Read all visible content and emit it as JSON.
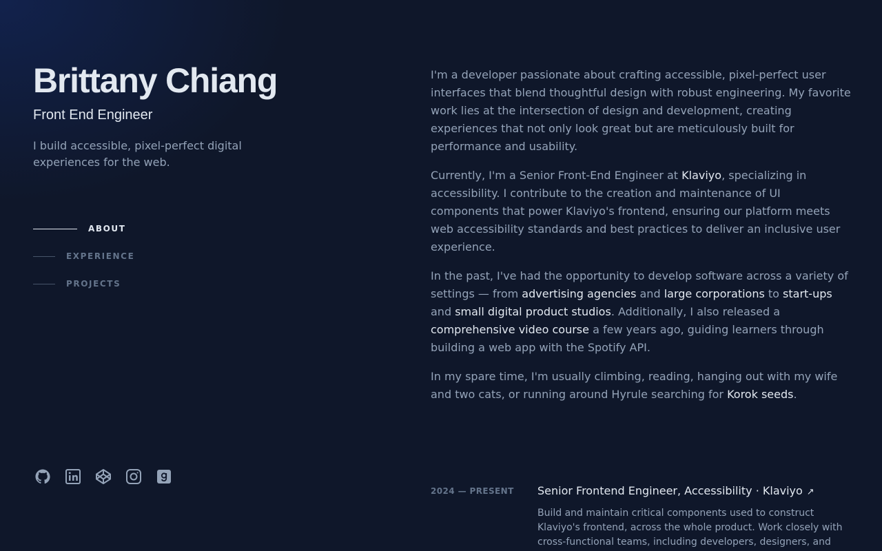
{
  "header": {
    "name": "Brittany Chiang",
    "role": "Front End Engineer",
    "tagline": "I build accessible, pixel-perfect digital experiences for the web."
  },
  "nav": {
    "items": [
      {
        "label": "ABOUT",
        "active": true
      },
      {
        "label": "EXPERIENCE",
        "active": false
      },
      {
        "label": "PROJECTS",
        "active": false
      }
    ]
  },
  "social": {
    "icons": [
      "github-icon",
      "linkedin-icon",
      "codepen-icon",
      "instagram-icon",
      "goodreads-icon"
    ]
  },
  "about": {
    "p1": "I'm a developer passionate about crafting accessible, pixel-perfect user interfaces that blend thoughtful design with robust engineering. My favorite work lies at the intersection of design and development, creating experiences that not only look great but are meticulously built for performance and usability.",
    "p2_a": "Currently, I'm a Senior Front-End Engineer at ",
    "p2_link": "Klaviyo",
    "p2_b": ", specializing in accessibility. I contribute to the creation and maintenance of UI components that power Klaviyo's frontend, ensuring our platform meets web accessibility standards and best practices to deliver an inclusive user experience.",
    "p3_a": "In the past, I've had the opportunity to develop software across a variety of settings — from ",
    "p3_link1": "advertising agencies",
    "p3_b": " and ",
    "p3_link2": "large corporations",
    "p3_c": " to ",
    "p3_link3": "start-ups",
    "p3_d": " and ",
    "p3_link4": "small digital product studios",
    "p3_e": ". Additionally, I also released a ",
    "p3_link5": "comprehensive video course",
    "p3_f": " a few years ago, guiding learners through building a web app with the Spotify API.",
    "p4_a": "In my spare time, I'm usually climbing, reading, hanging out with my wife and two cats, or running around Hyrule searching for ",
    "p4_link": "Korok seeds",
    "p4_b": "."
  },
  "experience": {
    "date": "2024 — PRESENT",
    "title": "Senior Frontend Engineer, Accessibility · Klaviyo",
    "arrow": "↗",
    "description": "Build and maintain critical components used to construct Klaviyo's frontend, across the whole product. Work closely with cross-functional teams, including developers, designers, and product"
  },
  "colors": {
    "background": "#0f172a",
    "heading": "#e2e8f0",
    "body_text": "#94a3b8",
    "muted": "#64748b"
  }
}
